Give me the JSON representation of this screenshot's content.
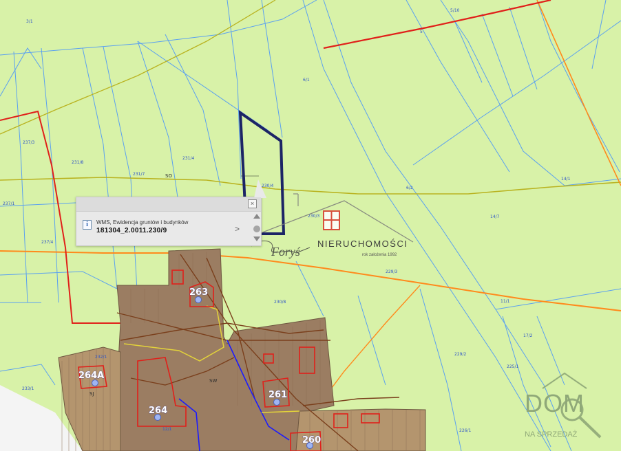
{
  "popup": {
    "layer_name": "WMS, Ewidencja gruntów i budynków",
    "parcel_id": "181304_2.0011.230/9",
    "close_glyph": "⊠",
    "next_glyph": ">"
  },
  "buildings": {
    "b263": "263",
    "b264": "264",
    "b264a": "264A",
    "b261": "261",
    "b260": "260"
  },
  "plots": {
    "p1": "3/1",
    "p2": "6/1",
    "p3": "5/10",
    "p4": "5",
    "p5": "237/3",
    "p6": "231/8",
    "p7": "231/4",
    "p8": "231/7",
    "p9": "230/4",
    "p10": "230/3",
    "p11": "237/1",
    "p12": "237/4",
    "p13": "14/7",
    "p14": "229/3",
    "p15": "230/8",
    "p16": "11/1",
    "p17": "17/2",
    "p18": "229/2",
    "p19": "225/1",
    "p20": "226/1",
    "p21": "233/1",
    "p22": "232/1",
    "p23": "6/2",
    "p24": "14/1",
    "p25": "12/1"
  },
  "road_labels": {
    "so": "SO",
    "sj": "SJ",
    "sw": "SW"
  },
  "watermark": {
    "company": "NIERUCHOMOŚCI",
    "signature": "Foryś",
    "tagline": "rok założenia 1992"
  },
  "corner_logo": {
    "main": "DOM",
    "sub": "NA SPRZEDAŻ"
  },
  "colors": {
    "land": "#d8f2a8",
    "building_area": "#9b7d62",
    "parcel_lines": "#5aa0f0",
    "red_line": "#e0201a",
    "orange_line": "#ff8a1c",
    "highlight": "#1c2466",
    "brand_red": "#d9342a",
    "badge_green": "#8fa878"
  },
  "icons": {
    "info": "info-icon",
    "close": "close-icon",
    "next": "chevron-right-icon",
    "scroll_up": "triangle-up-icon",
    "scroll_down": "triangle-down-icon"
  }
}
